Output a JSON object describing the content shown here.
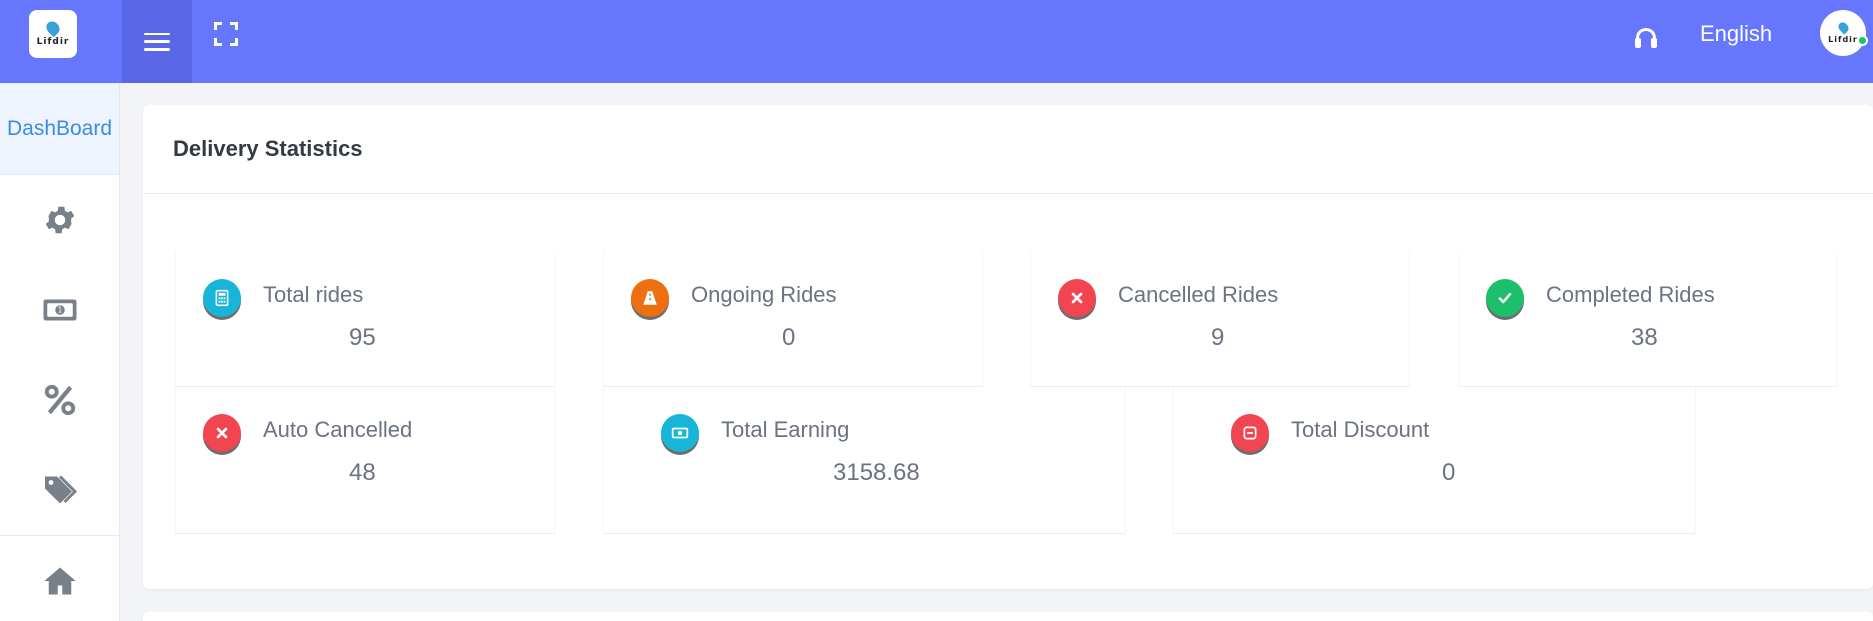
{
  "header": {
    "logo_text": "Lifdir",
    "language": "English",
    "icons": [
      "menu-icon",
      "fullscreen-icon",
      "headset-icon"
    ]
  },
  "sidebar": {
    "dashboard_label": "DashBoard",
    "items": [
      "gear-icon",
      "money-icon",
      "percent-icon",
      "tags-icon",
      "home-icon"
    ]
  },
  "main": {
    "title": "Delivery Statistics",
    "stats": [
      {
        "label": "Total rides",
        "value": "95",
        "icon": "calculator-icon",
        "color": "#17b6d9"
      },
      {
        "label": "Ongoing Rides",
        "value": "0",
        "icon": "road-icon",
        "color": "#ee6f0f"
      },
      {
        "label": "Cancelled Rides",
        "value": "9",
        "icon": "close-icon",
        "color": "#f24552"
      },
      {
        "label": "Completed Rides",
        "value": "38",
        "icon": "check-icon",
        "color": "#1dbf6a"
      },
      {
        "label": "Auto Cancelled",
        "value": "48",
        "icon": "close-icon",
        "color": "#f24552"
      },
      {
        "label": "Total Earning",
        "value": "3158.68",
        "icon": "money-icon",
        "color": "#17b6d9"
      },
      {
        "label": "Total Discount",
        "value": "0",
        "icon": "minus-square-icon",
        "color": "#f24552"
      }
    ]
  },
  "colors": {
    "topbar": "#6777fd",
    "accent": "#3b8de0"
  }
}
